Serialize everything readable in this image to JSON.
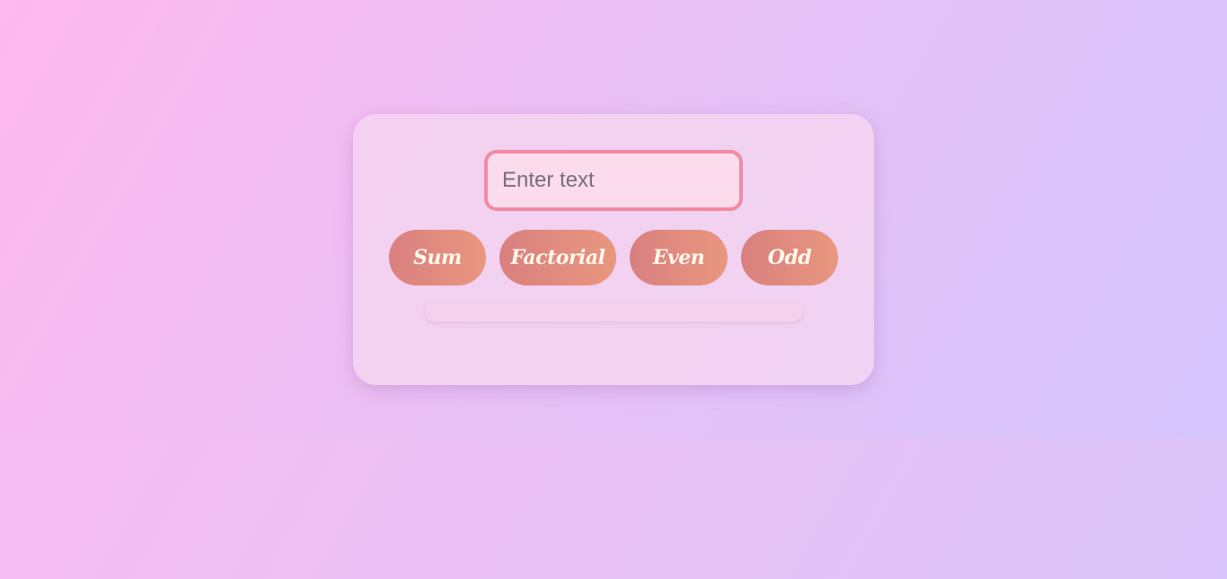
{
  "input": {
    "placeholder": "Enter text",
    "value": ""
  },
  "buttons": {
    "sum": "Sum",
    "factorial": "Factorial",
    "even": "Even",
    "odd": "Odd"
  },
  "result": {
    "text": ""
  },
  "colors": {
    "accent_border": "#f38aa1",
    "button_gradient_start": "#d9807f",
    "button_gradient_end": "#e9977f",
    "button_text": "#fff8ec"
  }
}
